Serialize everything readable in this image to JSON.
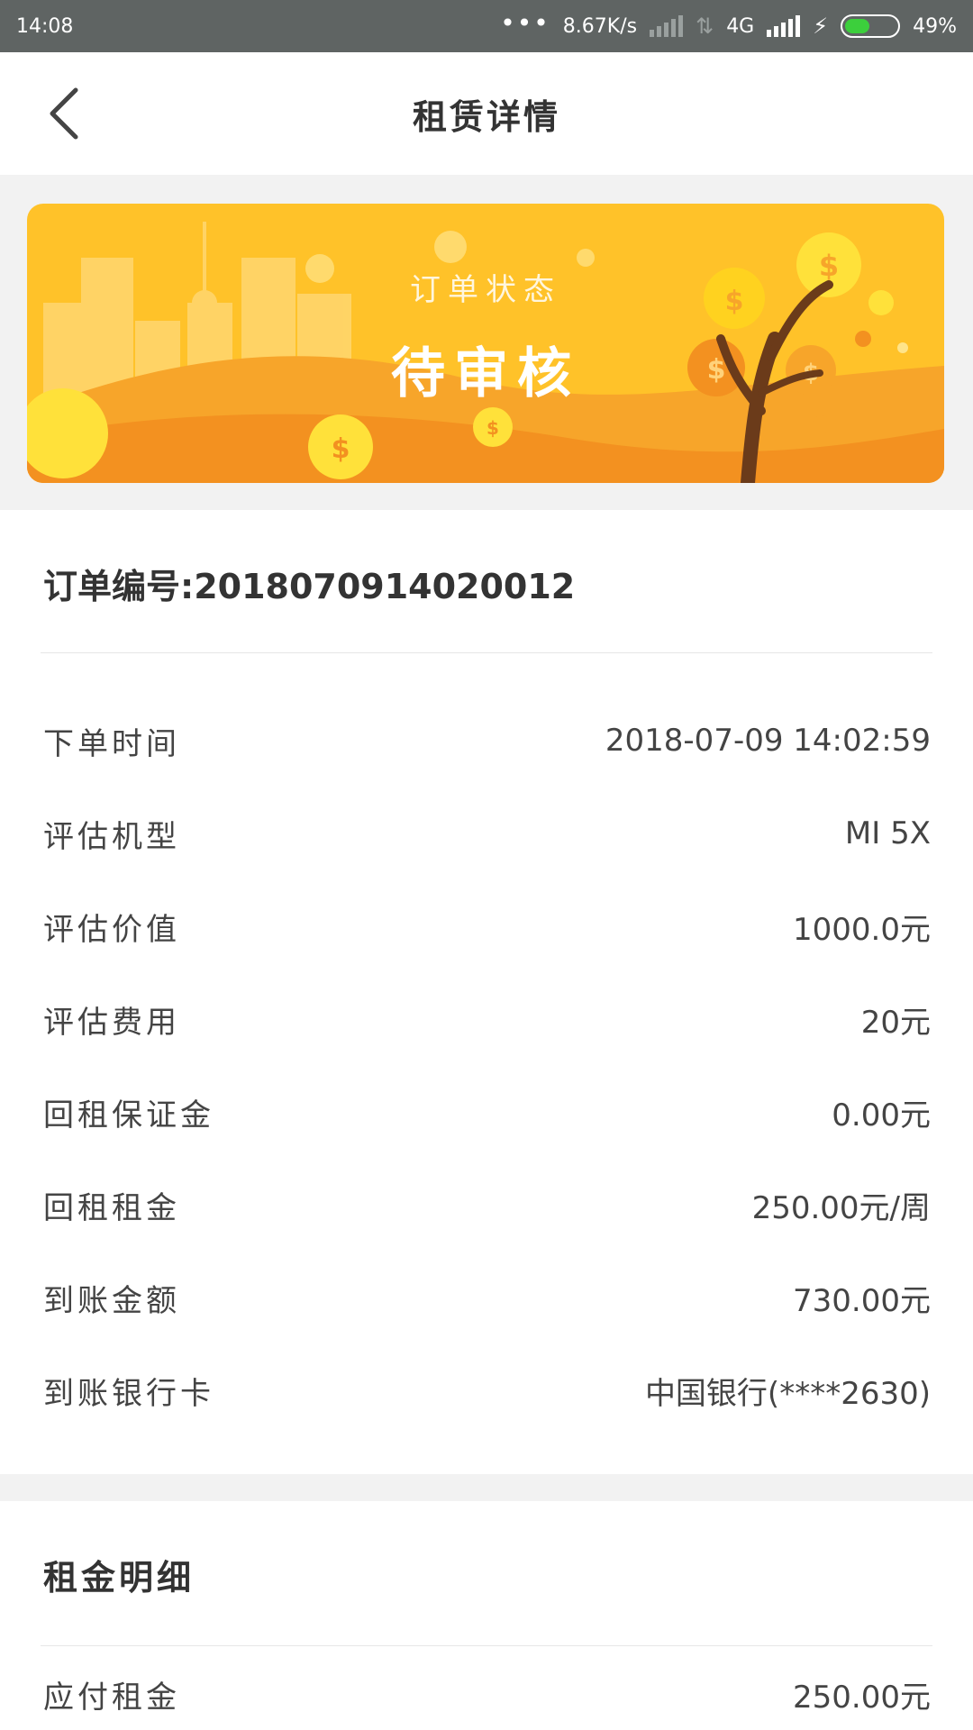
{
  "status_bar": {
    "time": "14:08",
    "speed": "8.67K/s",
    "network": "4G",
    "battery": "49%",
    "battery_level": 0.49
  },
  "header": {
    "title": "租赁详情",
    "back_icon": "chevron-left-icon"
  },
  "banner": {
    "label": "订单状态",
    "status": "待审核",
    "colors": {
      "background": "#ffc229",
      "hill": "#f5961d"
    }
  },
  "order": {
    "number_label": "订单编号:2018070914020012"
  },
  "details": [
    {
      "label": "下单时间",
      "value": "2018-07-09 14:02:59"
    },
    {
      "label": "评估机型",
      "value": "MI 5X"
    },
    {
      "label": "评估价值",
      "value": "1000.0元"
    },
    {
      "label": "评估费用",
      "value": "20元"
    },
    {
      "label": "回租保证金",
      "value": "0.00元"
    },
    {
      "label": "回租租金",
      "value": "250.00元/周"
    },
    {
      "label": "到账金额",
      "value": "730.00元"
    },
    {
      "label": "到账银行卡",
      "value": "中国银行(****2630)"
    }
  ],
  "rent_section": {
    "title": "租金明细",
    "rows": [
      {
        "label": "应付租金",
        "value": "250.00元"
      }
    ]
  }
}
